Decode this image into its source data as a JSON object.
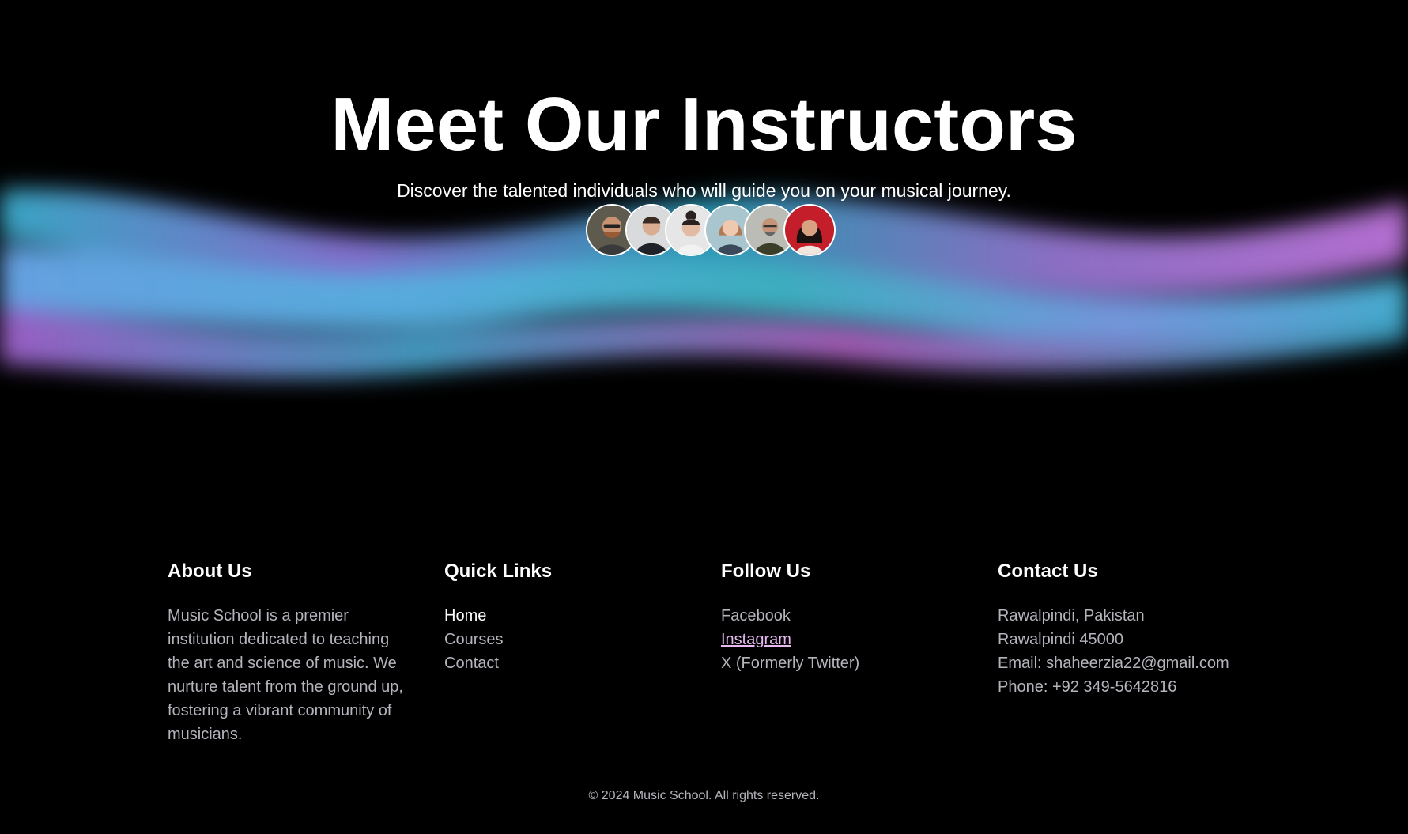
{
  "hero": {
    "title": "Meet Our Instructors",
    "subtitle": "Discover the talented individuals who will guide you on your musical journey.",
    "avatars": [
      {
        "icon": "instructor-avatar-1"
      },
      {
        "icon": "instructor-avatar-2"
      },
      {
        "icon": "instructor-avatar-3"
      },
      {
        "icon": "instructor-avatar-4"
      },
      {
        "icon": "instructor-avatar-5"
      },
      {
        "icon": "instructor-avatar-6"
      }
    ]
  },
  "footer": {
    "about": {
      "title": "About Us",
      "text": "Music School is a premier institution dedicated to teaching the art and science of music. We nurture talent from the ground up, fostering a vibrant community of musicians."
    },
    "quick_links": {
      "title": "Quick Links",
      "items": [
        "Home",
        "Courses",
        "Contact"
      ]
    },
    "follow": {
      "title": "Follow Us",
      "items": [
        "Facebook",
        "Instagram",
        "X (Formerly Twitter)"
      ]
    },
    "contact": {
      "title": "Contact Us",
      "lines": [
        "Rawalpindi, Pakistan",
        "Rawalpindi 45000",
        "Email: shaheerzia22@gmail.com",
        "Phone: +92 349-5642816"
      ]
    },
    "copyright": "© 2024 Music School. All rights reserved."
  },
  "colors": {
    "background": "#000000",
    "wave_cyan": "#3fb6d9",
    "wave_purple": "#b278e0",
    "wave_blue": "#6aa8ec",
    "muted_text": "#b4b4bc",
    "link_hover": "#e7b9f0"
  }
}
